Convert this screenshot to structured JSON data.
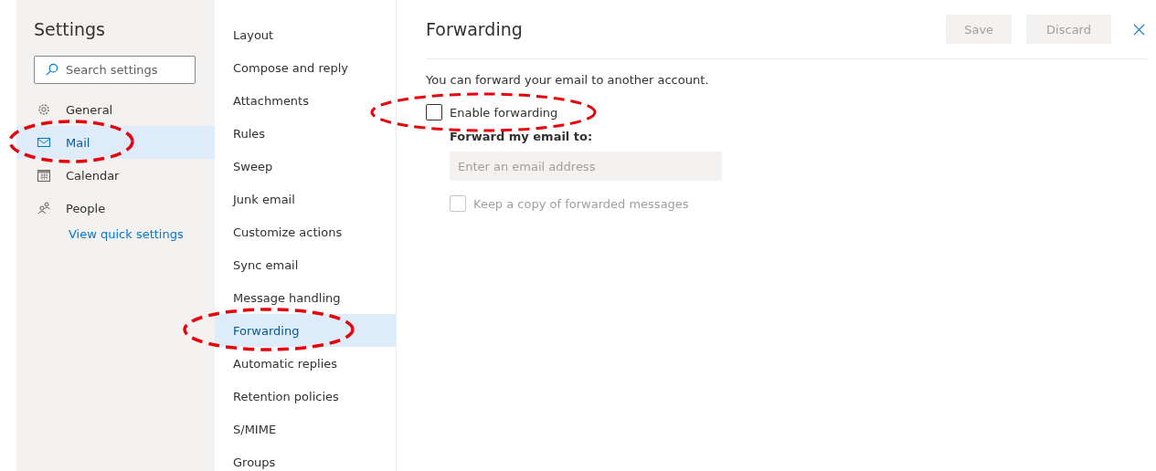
{
  "sidebar": {
    "title": "Settings",
    "search": {
      "placeholder": "Search settings"
    },
    "items": [
      {
        "label": "General",
        "selected": false,
        "circled": false
      },
      {
        "label": "Mail",
        "selected": true,
        "circled": true
      },
      {
        "label": "Calendar",
        "selected": false,
        "circled": false
      },
      {
        "label": "People",
        "selected": false,
        "circled": false
      }
    ],
    "link": "View quick settings"
  },
  "categories": [
    {
      "label": "Layout",
      "selected": false,
      "circled": false
    },
    {
      "label": "Compose and reply",
      "selected": false,
      "circled": false
    },
    {
      "label": "Attachments",
      "selected": false,
      "circled": false
    },
    {
      "label": "Rules",
      "selected": false,
      "circled": false
    },
    {
      "label": "Sweep",
      "selected": false,
      "circled": false
    },
    {
      "label": "Junk email",
      "selected": false,
      "circled": false
    },
    {
      "label": "Customize actions",
      "selected": false,
      "circled": false
    },
    {
      "label": "Sync email",
      "selected": false,
      "circled": false
    },
    {
      "label": "Message handling",
      "selected": false,
      "circled": false
    },
    {
      "label": "Forwarding",
      "selected": true,
      "circled": true
    },
    {
      "label": "Automatic replies",
      "selected": false,
      "circled": false
    },
    {
      "label": "Retention policies",
      "selected": false,
      "circled": false
    },
    {
      "label": "S/MIME",
      "selected": false,
      "circled": false
    },
    {
      "label": "Groups",
      "selected": false,
      "circled": false
    }
  ],
  "panel": {
    "title": "Forwarding",
    "buttons": [
      "Save",
      "Discard"
    ],
    "description": "You can forward your email to another account.",
    "enable": {
      "label": "Enable forwarding",
      "checked": false,
      "circled": true
    },
    "forward_label": "Forward my email to:",
    "email": {
      "placeholder": "Enter an email address"
    },
    "keep_copy": {
      "label": "Keep a copy of forwarded messages",
      "checked": false,
      "disabled": true
    }
  }
}
